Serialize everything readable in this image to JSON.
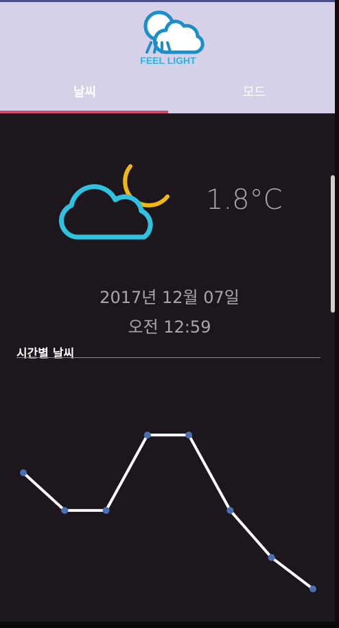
{
  "app": {
    "logo_text": "FEEL LIGHT",
    "tabs": [
      {
        "label": "날씨",
        "active": true
      },
      {
        "label": "모드",
        "active": false
      }
    ],
    "accent_color": "#d24b6f",
    "header_color": "#d6d0e8"
  },
  "weather": {
    "icon": "cloud-moon-icon",
    "temperature": "1.8°C",
    "date": "2017년 12월 07일",
    "time": "오전 12:59"
  },
  "hourly": {
    "title": "시간별 날씨"
  },
  "chart_data": {
    "type": "line",
    "x": [
      1,
      2,
      3,
      4,
      5,
      6,
      7,
      8
    ],
    "series": [
      {
        "values": [
          1.2,
          0.0,
          0.0,
          2.4,
          2.4,
          0.0,
          -1.5,
          -2.5
        ]
      }
    ],
    "ylim": [
      -3,
      4
    ],
    "grid": false
  }
}
